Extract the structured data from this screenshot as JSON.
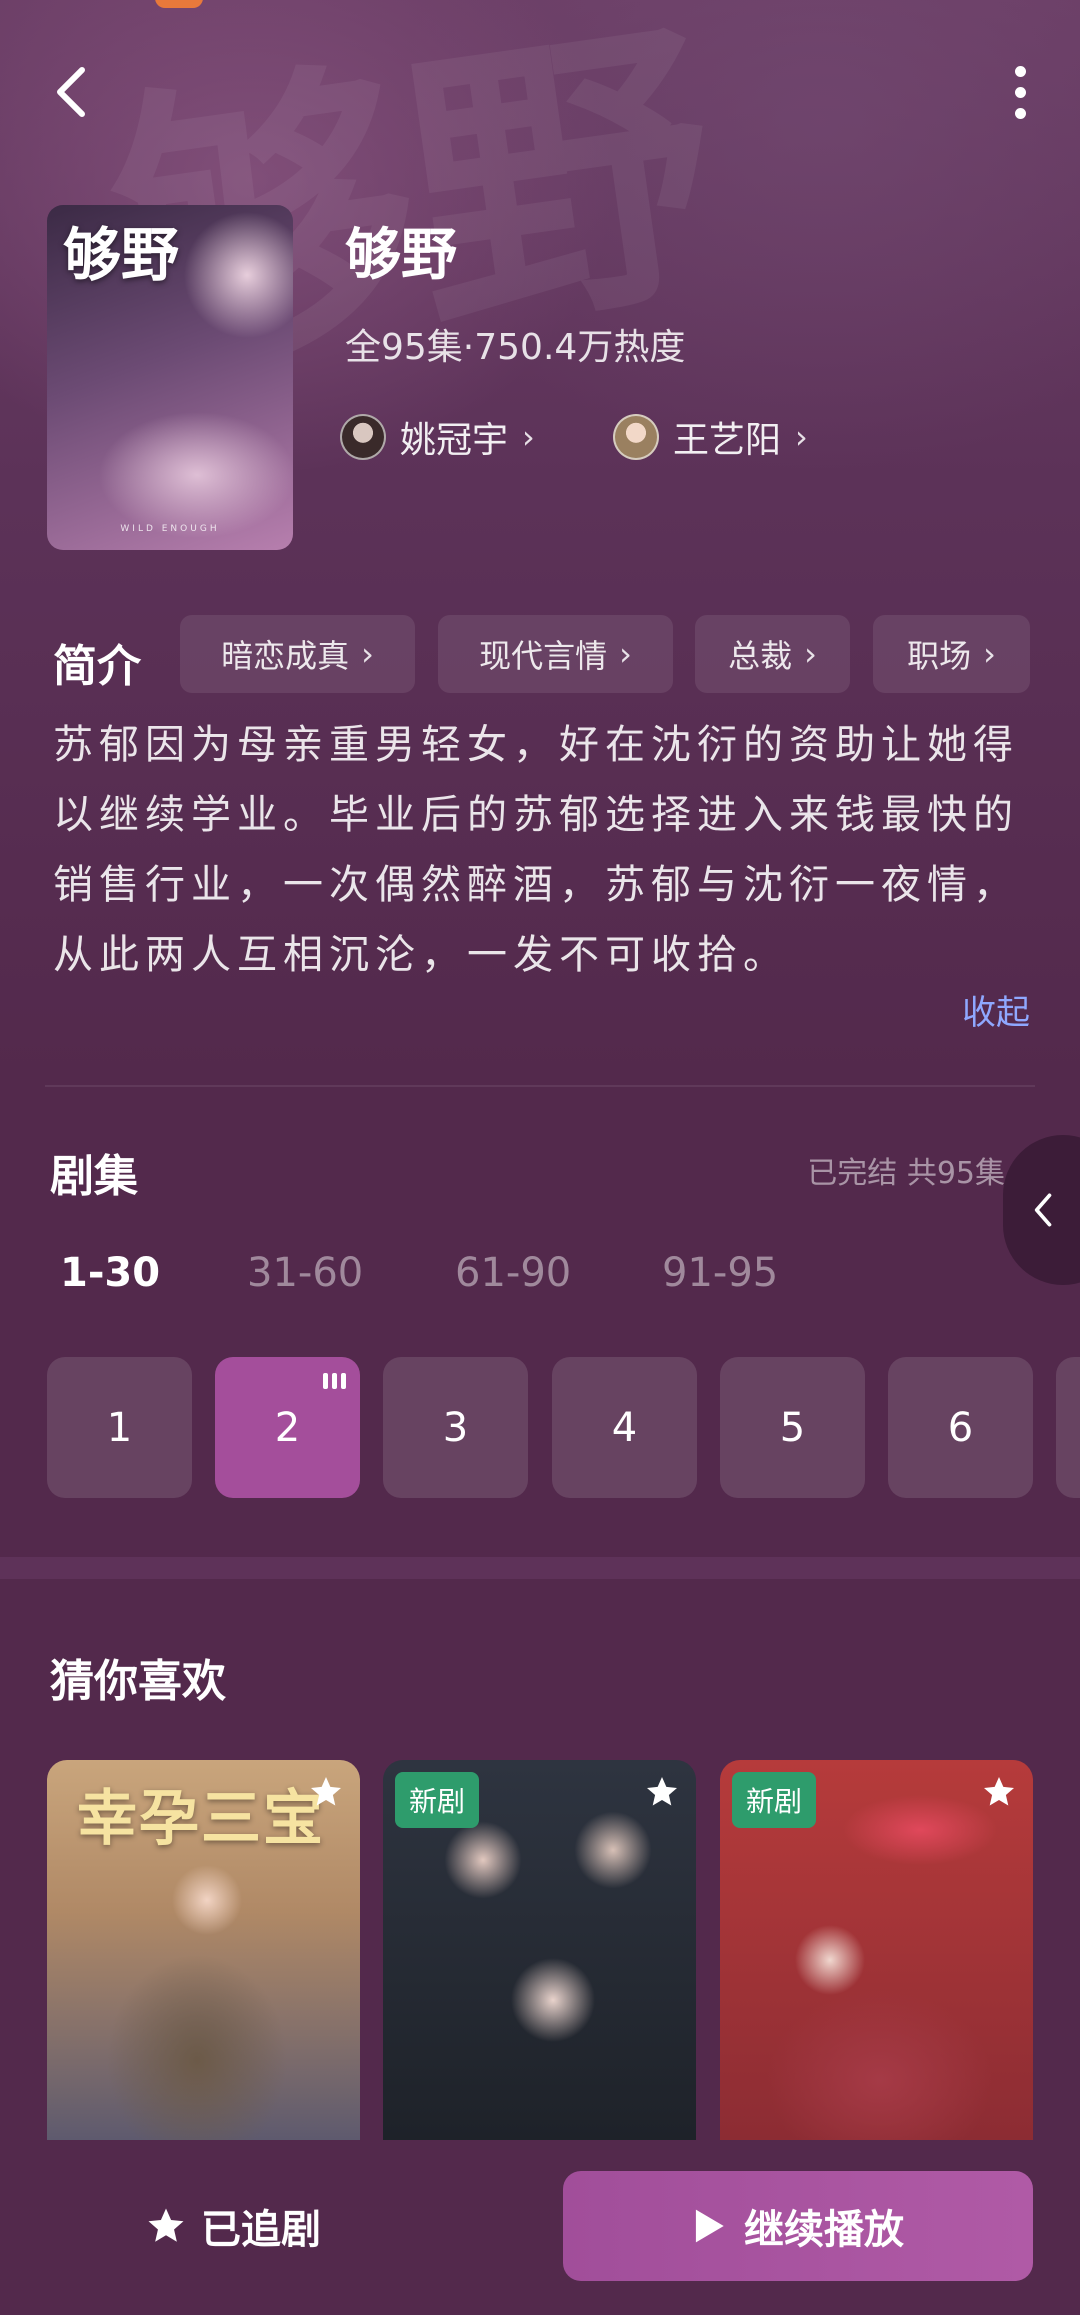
{
  "show": {
    "title": "够野",
    "poster_title": "够野",
    "poster_caption": "WILD ENOUGH",
    "meta": "全95集·750.4万热度",
    "actors": [
      {
        "name": "姚冠宇"
      },
      {
        "name": "王艺阳"
      }
    ]
  },
  "intro": {
    "heading": "简介",
    "tags": [
      "暗恋成真",
      "现代言情",
      "总裁",
      "职场"
    ],
    "text": "苏郁因为母亲重男轻女，好在沈衍的资助让她得以继续学业。毕业后的苏郁选择进入来钱最快的销售行业，一次偶然醉酒，苏郁与沈衍一夜情，从此两人互相沉沦，一发不可收拾。",
    "collapse": "收起"
  },
  "episodes": {
    "heading": "剧集",
    "status": "已完结 共95集",
    "ranges": [
      "1-30",
      "31-60",
      "61-90",
      "91-95"
    ],
    "active_range": 0,
    "cells": [
      "1",
      "2",
      "3",
      "4",
      "5",
      "6"
    ],
    "current": "2"
  },
  "recommend": {
    "heading": "猜你喜欢",
    "items": [
      {
        "title": "幸孕三宝",
        "badge": ""
      },
      {
        "title": "",
        "badge": "新剧"
      },
      {
        "title": "",
        "badge": "新剧"
      }
    ]
  },
  "bottom": {
    "follow": "已追剧",
    "play": "继续播放"
  },
  "colors": {
    "accent": "#a44e9b",
    "background": "#53294c",
    "link": "#8fa8ff",
    "badge": "#2e9c6c"
  }
}
